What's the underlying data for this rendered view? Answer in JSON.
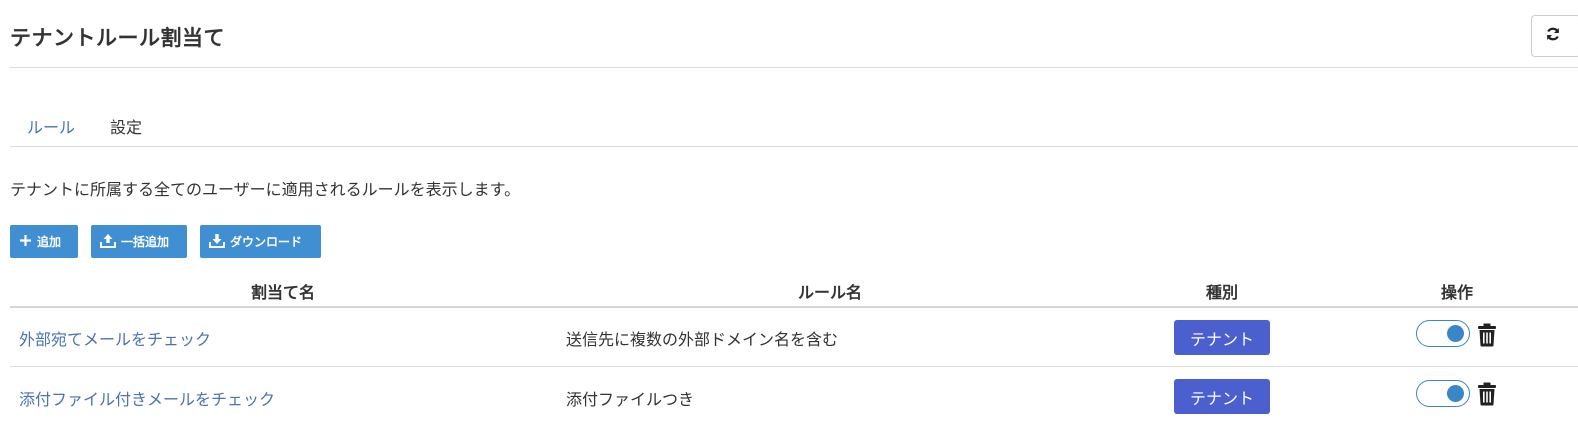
{
  "header": {
    "title": "テナントルール割当て",
    "refresh_icon": "refresh-icon"
  },
  "tabs": [
    {
      "label": "ルール",
      "active": true
    },
    {
      "label": "設定",
      "active": false
    }
  ],
  "description": "テナントに所属する全てのユーザーに適用されるルールを表示します。",
  "toolbar": {
    "add_label": "追加",
    "bulk_add_label": "一括追加",
    "download_label": "ダウンロード",
    "button_color": "#3f8fd2"
  },
  "table": {
    "columns": [
      "割当て名",
      "ルール名",
      "種別",
      "操作"
    ],
    "rows": [
      {
        "name": "外部宛てメールをチェック",
        "rule": "送信先に複数の外部ドメイン名を含む",
        "type": "テナント",
        "enabled": true
      },
      {
        "name": "添付ファイル付きメールをチェック",
        "rule": "添付ファイルつき",
        "type": "テナント",
        "enabled": true
      }
    ]
  },
  "colors": {
    "link": "#4a72b5",
    "badge": "#4c5fcf",
    "toggle": "#3a87c8"
  }
}
